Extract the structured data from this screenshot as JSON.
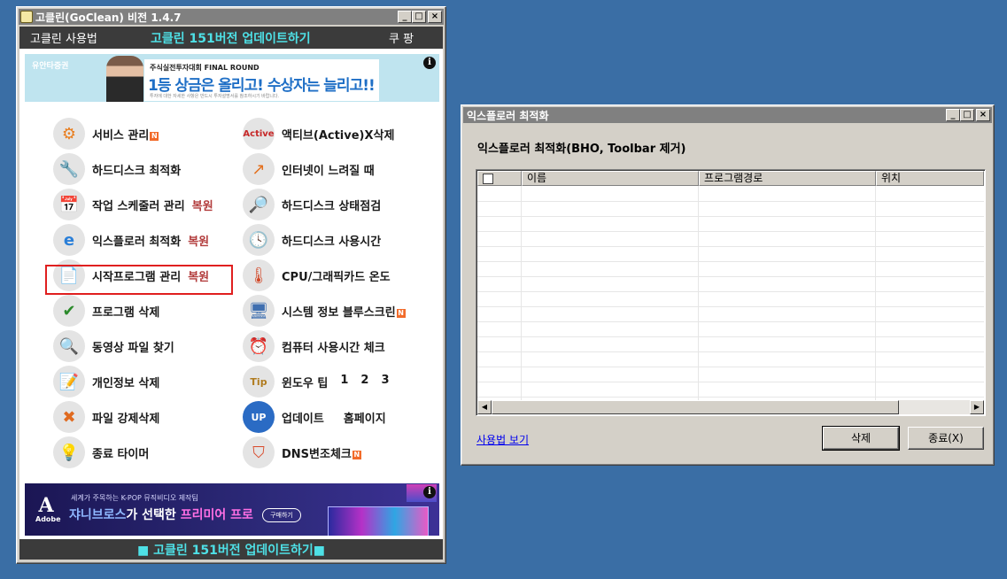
{
  "main_window": {
    "title": "고클린(GoClean) 비전 1.4.7",
    "window_buttons": [
      "_",
      "□",
      "×"
    ],
    "menu": {
      "usage": "고클린 사용법",
      "update": "고클린 151버전 업데이트하기",
      "coupang": "쿠 팡"
    },
    "ad_top": {
      "logo": "유안타증권",
      "subtitle": "주식실전투자대회 FINAL ROUND",
      "headline": "1등 상금은 올리고! 수상자는 늘리고!!",
      "fine_print": "투자에 대한 자세한 사항은 반드시 투자설명서를 참조하시기 바랍니다."
    },
    "left_items": [
      {
        "label": "서비스 관리",
        "badge": "N",
        "restore": ""
      },
      {
        "label": "하드디스크 최적화",
        "badge": "",
        "restore": ""
      },
      {
        "label": "작업 스케줄러 관리",
        "badge": "",
        "restore": "복원"
      },
      {
        "label": "익스플로러 최적화",
        "badge": "",
        "restore": "복원"
      },
      {
        "label": "시작프로그램 관리",
        "badge": "",
        "restore": "복원"
      },
      {
        "label": "프로그램 삭제",
        "badge": "",
        "restore": ""
      },
      {
        "label": "동영상 파일 찾기",
        "badge": "",
        "restore": ""
      },
      {
        "label": "개인정보 삭제",
        "badge": "",
        "restore": ""
      },
      {
        "label": "파일 강제삭제",
        "badge": "",
        "restore": ""
      },
      {
        "label": "종료 타이머",
        "badge": "",
        "restore": ""
      }
    ],
    "right_items": [
      {
        "label": "액티브(Active)X삭제",
        "badge": ""
      },
      {
        "label": "인터넷이 느려질 때",
        "badge": ""
      },
      {
        "label": "하드디스크 상태점검",
        "badge": ""
      },
      {
        "label": "하드디스크 사용시간",
        "badge": ""
      },
      {
        "label": "CPU/그래픽카드 온도",
        "badge": ""
      },
      {
        "label": "시스템 정보  블루스크린",
        "badge": "N"
      },
      {
        "label": "컴퓨터 사용시간 체크",
        "badge": ""
      },
      {
        "label": "윈도우 팁",
        "links": [
          "1",
          "2",
          "3"
        ],
        "badge": ""
      },
      {
        "label": "업데이트",
        "links": [
          "홈페이지"
        ],
        "badge": ""
      },
      {
        "label": "DNS변조체크",
        "badge": "N"
      }
    ],
    "ad_bottom": {
      "brand": "Adobe",
      "subtitle": "세계가 주목하는 K-POP 뮤직비디오 제작팀",
      "headline_part1": "쟈니브로스",
      "headline_part2": "가 선택한 ",
      "headline_part3": "프리미어 프로",
      "button": "구매하기"
    },
    "bottom_bar": "■ 고클린 151버전 업데이트하기■"
  },
  "ie_window": {
    "title": "익스플로러 최적화",
    "window_buttons": [
      "_",
      "□",
      "×"
    ],
    "header": "익스플로러 최적화(BHO, Toolbar 제거)",
    "columns": [
      "이름",
      "프로그램경로",
      "위치"
    ],
    "rows": [],
    "usage_link": "사용법 보기",
    "delete_button": "삭제",
    "close_button": "종료(X)"
  },
  "colors": {
    "desktop": "#3a6ea5",
    "menubar": "#3b3b3b",
    "update_text": "#4ee0e6",
    "restore_text": "#b23c3c",
    "highlight_border": "#e01f1f",
    "new_badge": "#f26b2a"
  }
}
